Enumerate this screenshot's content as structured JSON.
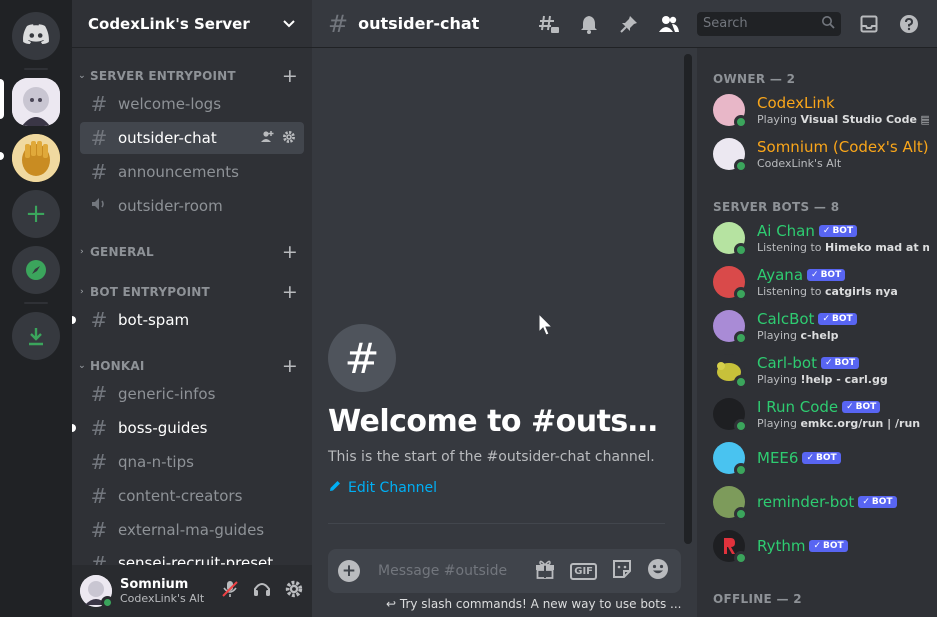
{
  "guilds": {
    "home_icon": "discord-logo-icon",
    "add_icon": "plus-icon",
    "explore_icon": "compass-icon",
    "download_icon": "download-icon",
    "colors": {
      "green": "#3ba55c"
    }
  },
  "server": {
    "name": "CodexLink's Server"
  },
  "categories": [
    {
      "label": "SERVER ENTRYPOINT"
    },
    {
      "label": "GENERAL"
    },
    {
      "label": "BOT ENTRYPOINT"
    },
    {
      "label": "HONKAI"
    }
  ],
  "channels": {
    "server_entrypoint": [
      "welcome-logs",
      "outsider-chat",
      "announcements",
      "outsider-room"
    ],
    "bot_entrypoint": [
      "bot-spam"
    ],
    "honkai": [
      "generic-infos",
      "boss-guides",
      "qna-n-tips",
      "content-creators",
      "external-ma-guides",
      "sensei-recruit-preset"
    ]
  },
  "user": {
    "name": "Somnium",
    "status": "CodexLink's Alt"
  },
  "topbar": {
    "channel": "outsider-chat",
    "search_placeholder": "Search"
  },
  "welcome": {
    "title": "Welcome to #outsider-chat!",
    "subtitle": "This is the start of the #outsider-chat channel.",
    "edit_label": "Edit Channel"
  },
  "composer": {
    "placeholder": "Message #outsider-chat",
    "gif_label": "GIF",
    "tip": "Try slash commands! A new way to use bots ..."
  },
  "members": {
    "owner_header": "OWNER — 2",
    "bots_header": "SERVER BOTS — 8",
    "offline_header": "OFFLINE — 2",
    "bot_badge": "BOT",
    "owners": [
      {
        "name": "CodexLink",
        "activity_prefix": "Playing ",
        "activity_bold": "Visual Studio Code",
        "color": "#faa61a"
      },
      {
        "name": "Somnium (Codex's Alt)",
        "activity_prefix": "CodexLink's Alt",
        "activity_bold": "",
        "color": "#faa61a"
      }
    ],
    "bots": [
      {
        "name": "Ai Chan",
        "activity_prefix": "Listening to ",
        "activity_bold": "Himeko mad at me",
        "color": "#2ecc71"
      },
      {
        "name": "Ayana",
        "activity_prefix": "Listening to ",
        "activity_bold": "catgirls nya",
        "color": "#2ecc71"
      },
      {
        "name": "CalcBot",
        "activity_prefix": "Playing ",
        "activity_bold": "c-help",
        "color": "#2ecc71"
      },
      {
        "name": "Carl-bot",
        "activity_prefix": "Playing ",
        "activity_bold": "!help - carl.gg",
        "color": "#2ecc71"
      },
      {
        "name": "I Run Code",
        "activity_prefix": "Playing ",
        "activity_bold": "emkc.org/run | /run",
        "color": "#2ecc71"
      },
      {
        "name": "MEE6",
        "activity_prefix": "",
        "activity_bold": "",
        "color": "#2ecc71"
      },
      {
        "name": "reminder-bot",
        "activity_prefix": "",
        "activity_bold": "",
        "color": "#2ecc71"
      },
      {
        "name": "Rythm",
        "activity_prefix": "",
        "activity_bold": "",
        "color": "#2ecc71"
      }
    ]
  }
}
